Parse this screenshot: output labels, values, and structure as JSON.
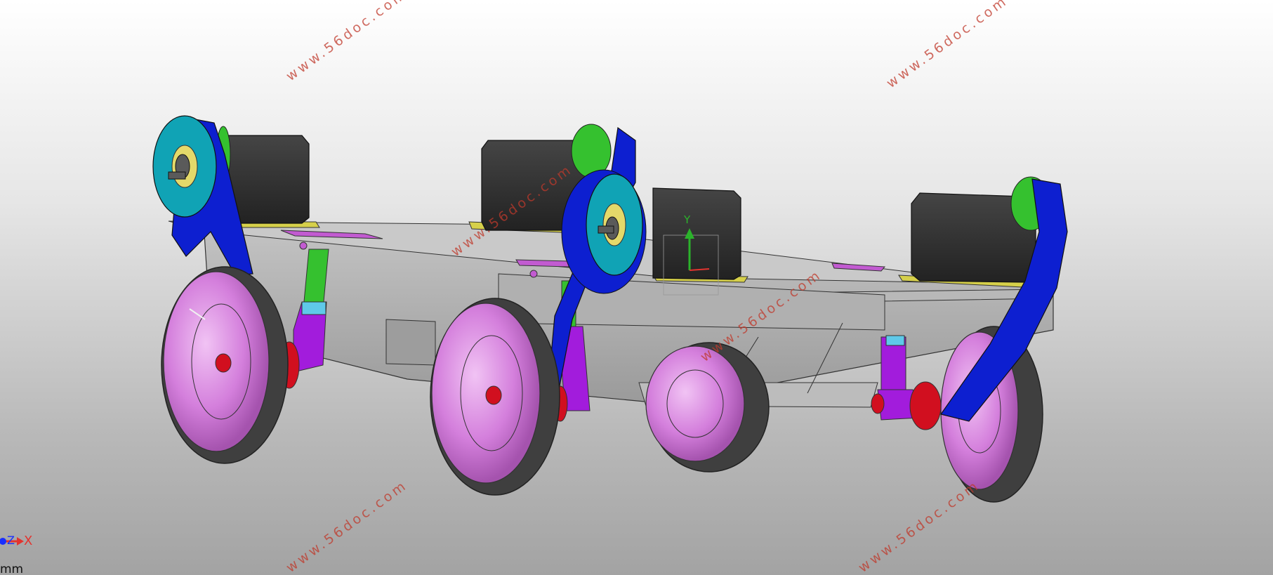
{
  "viewport": {
    "background_top": "#ffffff",
    "background_bottom": "#a3a3a3"
  },
  "colors": {
    "chassis": "#a6a6a6",
    "motor": "#2b2b2b",
    "flange_cyan": "#10a3b5",
    "arm_blue": "#0d1fd0",
    "disc_green": "#35c12f",
    "wheel_hub": "#d47fdc",
    "tire": "#3f3f3f",
    "bearing_red": "#d10f1f",
    "strut_purple": "#a21cdc",
    "plate_yellow": "#d6d04a"
  },
  "watermark": "www.56doc.com",
  "triad": {
    "x_label": "X",
    "y_label": "Y",
    "z_label": "Z"
  },
  "units": "mm"
}
